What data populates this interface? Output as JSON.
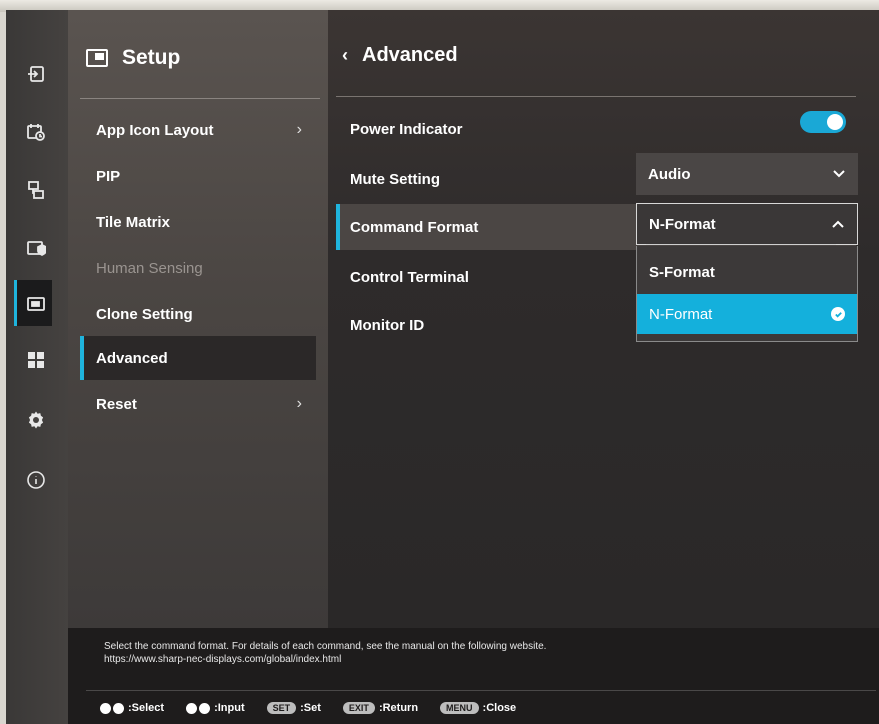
{
  "sidebar": {
    "title": "Setup",
    "items": [
      {
        "label": "App Icon Layout",
        "chevron": "›",
        "state": "normal"
      },
      {
        "label": "PIP",
        "chevron": "",
        "state": "normal"
      },
      {
        "label": "Tile Matrix",
        "chevron": "",
        "state": "normal"
      },
      {
        "label": "Human Sensing",
        "chevron": "",
        "state": "disabled"
      },
      {
        "label": "Clone Setting",
        "chevron": "",
        "state": "normal"
      },
      {
        "label": "Advanced",
        "chevron": "",
        "state": "selected"
      },
      {
        "label": "Reset",
        "chevron": "›",
        "state": "normal"
      }
    ]
  },
  "rail": {
    "icons": [
      "input-icon",
      "schedule-icon",
      "display-icon",
      "protect-icon",
      "setup-icon",
      "apps-icon",
      "settings-gear-icon",
      "info-icon"
    ],
    "active_index": 4,
    "accent_color": "#1fb4dd"
  },
  "main": {
    "back_glyph": "‹",
    "title": "Advanced",
    "settings": [
      {
        "label": "Power Indicator",
        "control": "toggle",
        "value": "on"
      },
      {
        "label": "Mute Setting",
        "control": "dropdown",
        "value": "Audio"
      },
      {
        "label": "Command Format",
        "control": "dropdown",
        "value": "N-Format",
        "open": true
      },
      {
        "label": "Control Terminal",
        "control": "none"
      },
      {
        "label": "Monitor ID",
        "control": "none"
      }
    ],
    "command_format_options": [
      {
        "label": "S-Format",
        "selected": false
      },
      {
        "label": "N-Format",
        "selected": true
      }
    ]
  },
  "help": {
    "line1": "Select the command format. For details of each command, see the manual on the following website.",
    "line2": "https://www.sharp-nec-displays.com/global/index.html"
  },
  "keys": [
    {
      "kind": "dots",
      "text": ":Select"
    },
    {
      "kind": "dots",
      "text": ":Input"
    },
    {
      "kind": "pill",
      "pill": "SET",
      "text": ":Set"
    },
    {
      "kind": "pill",
      "pill": "EXIT",
      "text": ":Return"
    },
    {
      "kind": "pill",
      "pill": "MENU",
      "text": ":Close"
    }
  ],
  "colors": {
    "accent": "#1fb4dd",
    "selected_option": "#14b0dc"
  }
}
